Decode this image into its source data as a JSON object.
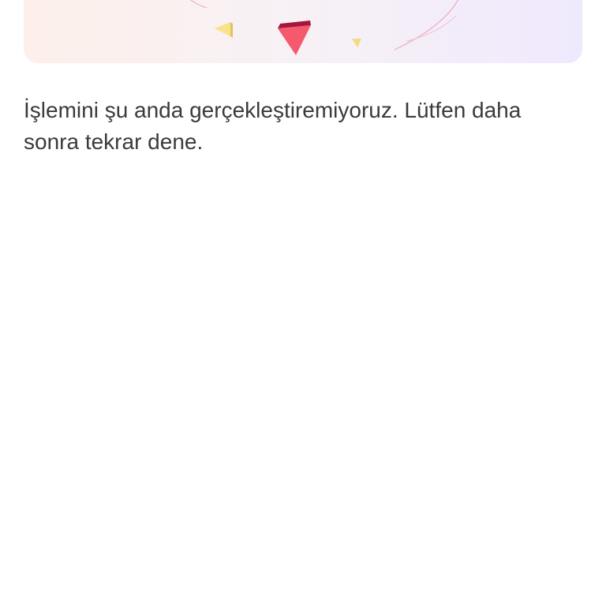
{
  "illustration": {
    "icons": [
      "confetti-arc-icon",
      "pink-triangle-icon",
      "yellow-triangle-icon"
    ],
    "colors": {
      "card_start": "#fdf0ea",
      "card_end": "#efe9fd",
      "pink": "#f4596e",
      "pink_dark": "#a3183a",
      "yellow": "#f7e38a"
    }
  },
  "error": {
    "message": "İşlemini şu anda gerçekleştiremiyoruz. Lütfen daha sonra tekrar dene."
  }
}
